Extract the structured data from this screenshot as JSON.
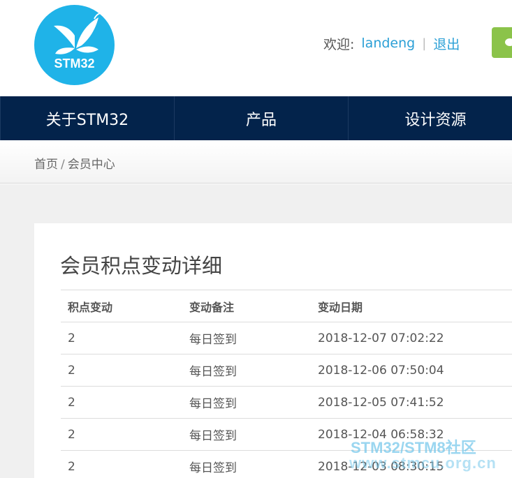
{
  "header": {
    "logo_text": "STM32",
    "welcome_label": "欢迎:",
    "username": "landeng",
    "separator": "|",
    "logout_label": "退出"
  },
  "nav": {
    "items": [
      {
        "label": "关于STM32"
      },
      {
        "label": "产品"
      },
      {
        "label": "设计资源"
      }
    ]
  },
  "breadcrumb": {
    "home": "首页",
    "separator": "/",
    "current": "会员中心"
  },
  "panel": {
    "title": "会员积点变动详细",
    "columns": [
      "积点变动",
      "变动备注",
      "变动日期"
    ],
    "rows": [
      {
        "points": "2",
        "note": "每日签到",
        "date": "2018-12-07 07:02:22"
      },
      {
        "points": "2",
        "note": "每日签到",
        "date": "2018-12-06 07:50:04"
      },
      {
        "points": "2",
        "note": "每日签到",
        "date": "2018-12-05 07:41:52"
      },
      {
        "points": "2",
        "note": "每日签到",
        "date": "2018-12-04 06:58:32"
      },
      {
        "points": "2",
        "note": "每日签到",
        "date": "2018-12-03 08:30:15"
      }
    ]
  },
  "watermark": {
    "line1": "STM32/STM8社区",
    "line2": "www.stmcu.org.cn"
  },
  "colors": {
    "nav_bg": "#03234b",
    "link": "#2a9fd6",
    "logo_bg": "#1fb3e8",
    "wechat": "#8bc34a"
  }
}
